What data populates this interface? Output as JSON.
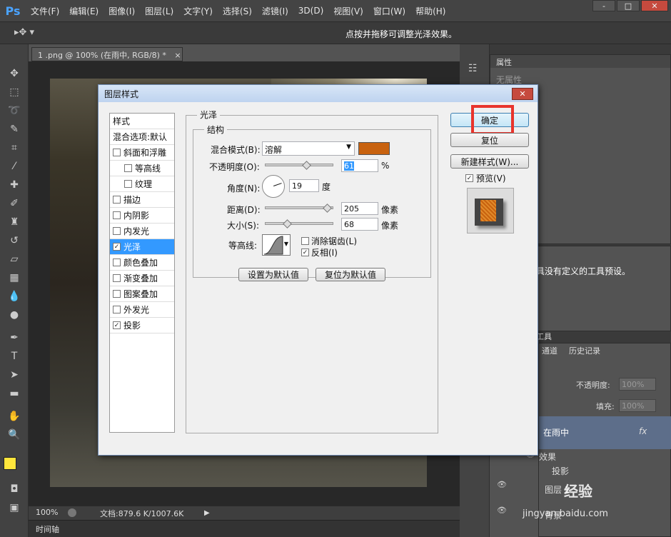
{
  "app": {
    "logo": "Ps",
    "hint": "点按并拖移可调整光泽效果。"
  },
  "menu": [
    "文件(F)",
    "编辑(E)",
    "图像(I)",
    "图层(L)",
    "文字(Y)",
    "选择(S)",
    "滤镜(I)",
    "3D(D)",
    "视图(V)",
    "窗口(W)",
    "帮助(H)"
  ],
  "window_controls": {
    "minimize": "-",
    "maximize": "□",
    "close": "✕"
  },
  "document": {
    "tab_title": "1 .png @ 100% (在雨中, RGB/8) *",
    "tab_close": "×",
    "zoom": "100%",
    "doc_info": "文档:879.6 K/1007.6K",
    "timeline": "时间轴"
  },
  "panels": {
    "properties_tab": "属性",
    "no_properties": "无属性",
    "tool_preset_text": "具没有定义的工具预设。",
    "tools_label": "工具",
    "channels_tab": "通道",
    "history_tab": "历史记录",
    "opacity_label": "不透明度:",
    "opacity_value": "100%",
    "fill_label": "填充:",
    "fill_value": "100%",
    "layers": [
      {
        "name": "在雨中",
        "fx": "fx"
      },
      {
        "name": "效果"
      },
      {
        "name": "投影"
      },
      {
        "name": "图层 1"
      },
      {
        "name": "背景"
      }
    ]
  },
  "dialog": {
    "title": "图层样式",
    "close": "✕",
    "styles": [
      {
        "label": "样式",
        "checkbox": false,
        "checked": false
      },
      {
        "label": "混合选项:默认",
        "checkbox": false,
        "checked": false
      },
      {
        "label": "斜面和浮雕",
        "checkbox": true,
        "checked": false
      },
      {
        "label": "等高线",
        "checkbox": true,
        "checked": false,
        "indent": true
      },
      {
        "label": "纹理",
        "checkbox": true,
        "checked": false,
        "indent": true
      },
      {
        "label": "描边",
        "checkbox": true,
        "checked": false
      },
      {
        "label": "内阴影",
        "checkbox": true,
        "checked": false
      },
      {
        "label": "内发光",
        "checkbox": true,
        "checked": false
      },
      {
        "label": "光泽",
        "checkbox": true,
        "checked": true,
        "selected": true
      },
      {
        "label": "颜色叠加",
        "checkbox": true,
        "checked": false
      },
      {
        "label": "渐变叠加",
        "checkbox": true,
        "checked": false
      },
      {
        "label": "图案叠加",
        "checkbox": true,
        "checked": false
      },
      {
        "label": "外发光",
        "checkbox": true,
        "checked": false
      },
      {
        "label": "投影",
        "checkbox": true,
        "checked": true
      }
    ],
    "section_title": "光泽",
    "structure_title": "结构",
    "blend_mode_label": "混合模式(B):",
    "blend_mode_value": "溶解",
    "blend_color": "#c8620f",
    "opacity_label": "不透明度(O):",
    "opacity_value": "61",
    "opacity_unit": "%",
    "angle_label": "角度(N):",
    "angle_value": "19",
    "angle_unit": "度",
    "distance_label": "距离(D):",
    "distance_value": "205",
    "distance_unit": "像素",
    "size_label": "大小(S):",
    "size_value": "68",
    "size_unit": "像素",
    "contour_label": "等高线:",
    "antialias_label": "消除锯齿(L)",
    "invert_label": "反相(I)",
    "make_default": "设置为默认值",
    "reset_default": "复位为默认值",
    "ok": "确定",
    "reset": "复位",
    "new_style": "新建样式(W)...",
    "preview_label": "预览(V)"
  },
  "colors": {
    "highlight_box": "#e8342c",
    "foreground": "#ffe63c",
    "background": "#ffffff"
  },
  "watermark": {
    "site": "jingyan.baidu.com",
    "name": "经验"
  }
}
